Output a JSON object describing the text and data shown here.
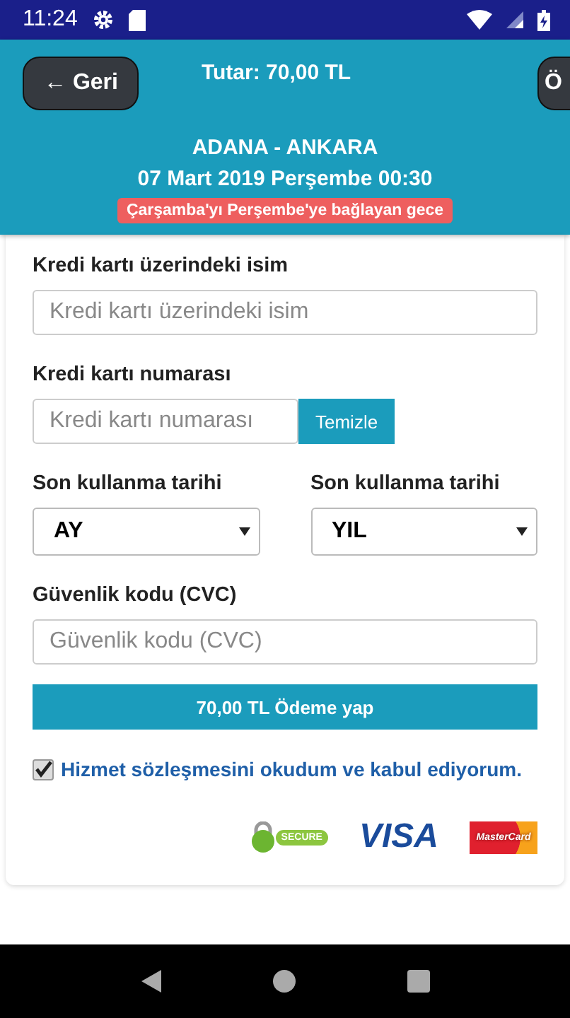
{
  "status_bar": {
    "time": "11:24"
  },
  "top_bar": {
    "back_button": "← Geri",
    "total": "Tutar: 70,00 TL",
    "next_button": "Ö"
  },
  "trip": {
    "route": "ADANA - ANKARA",
    "date": "07 Mart 2019 Perşembe 00:30",
    "note": "Çarşamba'yı Perşembe'ye bağlayan gece"
  },
  "form": {
    "name": {
      "label": "Kredi kartı üzerindeki isim",
      "placeholder": "Kredi kartı üzerindeki isim"
    },
    "number": {
      "label": "Kredi kartı numarası",
      "placeholder": "Kredi kartı numarası",
      "clear_button": "Temizle"
    },
    "expiry": [
      {
        "label": "Son kullanma tarihi",
        "value": "AY"
      },
      {
        "label": "Son kullanma tarihi",
        "value": "YIL"
      }
    ],
    "cvc": {
      "label": "Güvenlik kodu (CVC)",
      "placeholder": "Güvenlik kodu (CVC)"
    },
    "pay_button": "70,00 TL Ödeme yap",
    "agreement": {
      "text": "Hizmet sözleşmesini okudum ve kabul ediyorum.",
      "checked": true
    }
  },
  "logos": {
    "secure": "SECURE",
    "visa": "VISA",
    "mastercard": "MasterCard"
  }
}
